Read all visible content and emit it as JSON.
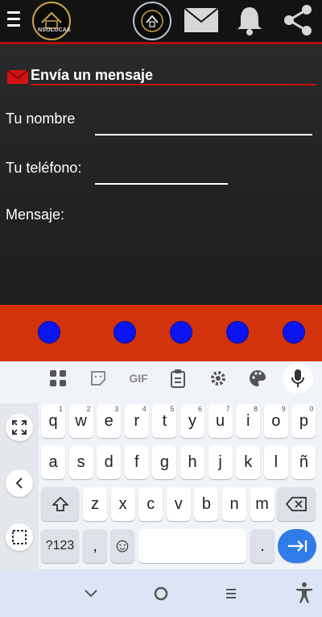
{
  "header": {
    "logo_text": "NSOLUCAS",
    "icons": [
      "menu-icon",
      "logo",
      "house-logo-icon",
      "mail-icon",
      "bell-icon",
      "share-icon"
    ]
  },
  "form": {
    "title": "Envía un mensaje",
    "name_label": "Tu nombre",
    "phone_label": "Tu teléfono:",
    "message_label": "Mensaje:",
    "name_value": "",
    "phone_value": ""
  },
  "band": {
    "dot_count": 5,
    "dot_color": "#0a14ee",
    "band_color": "#d2330b"
  },
  "keyboard": {
    "toolbar": [
      "apps-icon",
      "sticker-icon",
      "GIF",
      "clipboard-icon",
      "settings-icon",
      "palette-icon",
      "mic-icon"
    ],
    "gif_label": "GIF",
    "row1": [
      {
        "k": "q",
        "s": "1"
      },
      {
        "k": "w",
        "s": "2"
      },
      {
        "k": "e",
        "s": "3"
      },
      {
        "k": "r",
        "s": "4"
      },
      {
        "k": "t",
        "s": "5"
      },
      {
        "k": "y",
        "s": "6"
      },
      {
        "k": "u",
        "s": "7"
      },
      {
        "k": "i",
        "s": "8"
      },
      {
        "k": "o",
        "s": "9"
      },
      {
        "k": "p",
        "s": "0"
      }
    ],
    "row2": [
      "a",
      "s",
      "d",
      "f",
      "g",
      "h",
      "j",
      "k",
      "l",
      "ñ"
    ],
    "row3": [
      "z",
      "x",
      "c",
      "v",
      "b",
      "n",
      "m"
    ],
    "symbols_label": "?123",
    "comma_label": ",",
    "period_label": ".",
    "emoji_label": "☺"
  },
  "colors": {
    "accent": "#b01010",
    "enter": "#2f7be8"
  }
}
